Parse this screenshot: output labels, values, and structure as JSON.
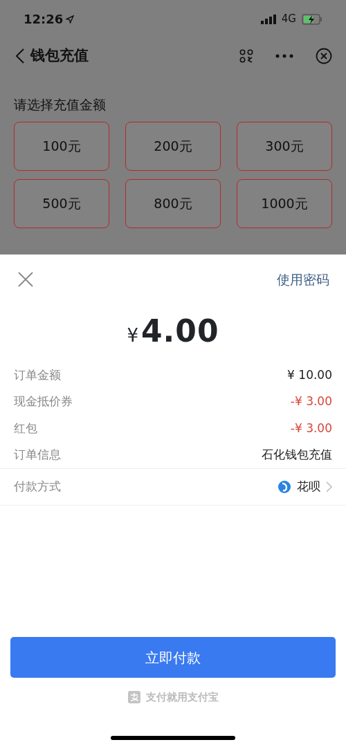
{
  "status_bar": {
    "time": "12:26",
    "network": "4G"
  },
  "nav": {
    "title": "钱包充值"
  },
  "section_title": "请选择充值金额",
  "amounts": [
    {
      "label": "100元"
    },
    {
      "label": "200元"
    },
    {
      "label": "300元"
    },
    {
      "label": "500元"
    },
    {
      "label": "800元"
    },
    {
      "label": "1000元"
    }
  ],
  "sheet": {
    "use_password": "使用密码",
    "currency": "¥",
    "amount": "4.00",
    "details": [
      {
        "label": "订单金额",
        "value": "¥ 10.00",
        "kind": "normal"
      },
      {
        "label": "现金抵价券",
        "value": "-¥ 3.00",
        "kind": "discount"
      },
      {
        "label": "红包",
        "value": "-¥ 3.00",
        "kind": "discount"
      },
      {
        "label": "订单信息",
        "value": "石化钱包充值",
        "kind": "info"
      }
    ],
    "payment": {
      "label": "付款方式",
      "method": "花呗"
    },
    "pay_button": "立即付款",
    "footer": "支付就用支付宝"
  }
}
